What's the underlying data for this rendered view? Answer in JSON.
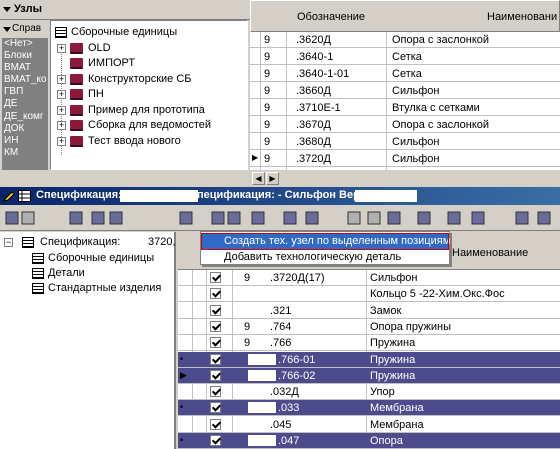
{
  "top_left": {
    "title": "Узлы",
    "sprav_label": "Справ",
    "sprav_items": [
      "<Нет>",
      "Блоки",
      "ВМАТ",
      "ВМАТ_ко",
      "ГВП",
      "ДЕ",
      "ДЕ_комг",
      "ДОК",
      "ИН",
      "КМ"
    ],
    "tree": [
      {
        "label": "Сборочные единицы",
        "icon": "grid-icon",
        "level": 0
      },
      {
        "label": "OLD",
        "icon": "book-icon",
        "level": 1,
        "expandable": true
      },
      {
        "label": "ИМПОРТ",
        "icon": "book-icon",
        "level": 1,
        "expandable": false
      },
      {
        "label": "Конструкторские СБ",
        "icon": "book-icon",
        "level": 1,
        "expandable": true
      },
      {
        "label": "ПН",
        "icon": "book-icon",
        "level": 1,
        "expandable": true
      },
      {
        "label": "Пример для прототипа",
        "icon": "book-icon",
        "level": 1,
        "expandable": true
      },
      {
        "label": "Сборка для ведомостей",
        "icon": "book-icon",
        "level": 1,
        "expandable": true
      },
      {
        "label": "Тест ввода нового",
        "icon": "book-icon",
        "level": 1,
        "expandable": true
      }
    ]
  },
  "top_grid": {
    "headers": [
      "Обозначение",
      "Наименовани"
    ],
    "rows": [
      {
        "c0": "9",
        "oboz": ".3620Д",
        "name": "Опора с заслонкой"
      },
      {
        "c0": "9",
        "oboz": ".3640-1",
        "name": "Сетка"
      },
      {
        "c0": "9",
        "oboz": ".3640-1-01",
        "name": "Сетка"
      },
      {
        "c0": "9",
        "oboz": ".3660Д",
        "name": "Сильфон"
      },
      {
        "c0": "9",
        "oboz": ".3710Е-1",
        "name": "Втулка с сетками"
      },
      {
        "c0": "9",
        "oboz": ".3670Д",
        "name": "Опора с заслонкой"
      },
      {
        "c0": "9",
        "oboz": ".3680Д",
        "name": "Сильфон"
      },
      {
        "c0": "9",
        "oboz": ".3720Д",
        "name": "Сильфон"
      }
    ]
  },
  "titlebar": {
    "text": "Спецификация:                   - Сильфон\\\\Спецификация:              - Сильфон Версия: Импо"
  },
  "context_menu": {
    "items": [
      "Создать тех. узел по выделенным позициям",
      "Добавить технологическую деталь"
    ]
  },
  "bottom_tree": {
    "root_label": "Спецификация:",
    "root_suffix": "3720,",
    "children": [
      "Сборочные единицы",
      "Детали",
      "Стандартные изделия"
    ]
  },
  "bottom_grid": {
    "header_name": "Наименование",
    "rows": [
      {
        "c0": "9",
        "oboz": ".3720Д(17)",
        "name": "Сильфон",
        "sel": false,
        "marker": ""
      },
      {
        "c0": "",
        "oboz": "",
        "name": "Кольцо 5             -22-Хим.Окс.Фос",
        "sel": false,
        "marker": ""
      },
      {
        "c0": "",
        "oboz": ".321",
        "name": "Замок",
        "sel": false,
        "marker": ""
      },
      {
        "c0": "9",
        "oboz": ".764",
        "name": "Опора пружины",
        "sel": false,
        "marker": ""
      },
      {
        "c0": "9",
        "oboz": ".766",
        "name": "Пружина",
        "sel": false,
        "marker": ""
      },
      {
        "c0": "",
        "oboz": ".766-01",
        "name": "Пружина",
        "sel": true,
        "marker": "•"
      },
      {
        "c0": "",
        "oboz": ".766-02",
        "name": "Пружина",
        "sel": true,
        "marker": "▶"
      },
      {
        "c0": "",
        "oboz": ".032Д",
        "name": "Упор",
        "sel": false,
        "marker": ""
      },
      {
        "c0": "",
        "oboz": ".033",
        "name": "Мембрана",
        "sel": true,
        "marker": "•"
      },
      {
        "c0": "",
        "oboz": ".045",
        "name": "Мембрана",
        "sel": false,
        "marker": ""
      },
      {
        "c0": "",
        "oboz": ".047",
        "name": "Опора",
        "sel": true,
        "marker": "•"
      }
    ]
  }
}
